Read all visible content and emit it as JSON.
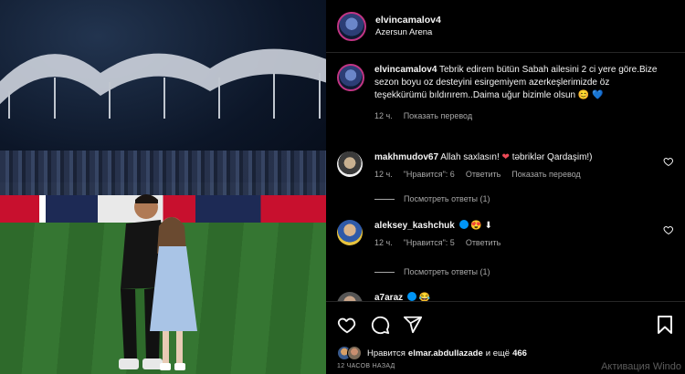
{
  "post": {
    "username": "elvincamalov4",
    "location": "Azersun Arena",
    "caption_user": "elvincamalov4",
    "caption": "Tebrik edirem bütün Sabah ailesini 2 ci yere göre.Bize sezon boyu oz desteyini esirgemiyem azerkeşlerimizde öz teşekkürümü bıldırırem..Daima uğur bizimle olsun",
    "caption_emoji": "😊 💙",
    "caption_time": "12 ч.",
    "caption_translate": "Показать перевод"
  },
  "comments": [
    {
      "username": "makhmudov67",
      "text": "Allah saxlasın!",
      "text_after": "təbriklər Qardaşim!)",
      "emoji": "❤",
      "time": "12 ч.",
      "likes": "\"Нравится\": 6",
      "reply": "Ответить",
      "translate": "Показать перевод",
      "replies_label": "Посмотреть ответы (1)"
    },
    {
      "username": "aleksey_kashchuk",
      "text": "",
      "emoji": "😍 ⬇",
      "time": "12 ч.",
      "likes": "\"Нравится\": 5",
      "reply": "Ответить",
      "replies_label": "Посмотреть ответы (1)"
    },
    {
      "username": "a7araz",
      "emoji": "😂"
    }
  ],
  "likes": {
    "prefix": "Нравится",
    "user": "elmar.abdullazade",
    "suffix": "и ещё",
    "count": "466"
  },
  "time_ago": "12 ЧАСОВ НАЗАД",
  "watermark": "Активация Windo",
  "icons": [
    "heart-icon",
    "comment-icon",
    "share-icon",
    "bookmark-icon"
  ],
  "colors": {
    "background": "#000000",
    "muted": "#a8a8a8",
    "heart_red": "#ed4956",
    "blue_heart": "#2f80ed"
  }
}
